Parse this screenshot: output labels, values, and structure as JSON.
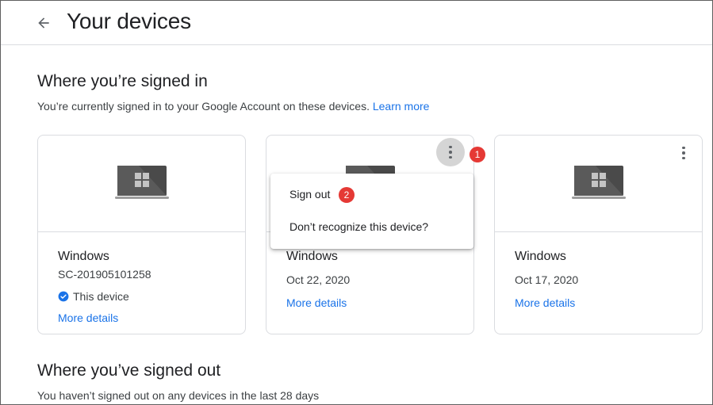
{
  "header": {
    "title": "Your devices"
  },
  "signed_in": {
    "title": "Where you’re signed in",
    "description": "You’re currently signed in to your Google Account on these devices.",
    "learn_more": "Learn more"
  },
  "devices": [
    {
      "name": "Windows",
      "detail": "SC-201905101258",
      "status": "This device",
      "more": "More details"
    },
    {
      "name": "Windows",
      "detail": "Oct 22, 2020",
      "more": "More details"
    },
    {
      "name": "Windows",
      "detail": "Oct 17, 2020",
      "more": "More details"
    }
  ],
  "menu": {
    "items": [
      {
        "label": "Sign out"
      },
      {
        "label": "Don’t recognize this device?"
      }
    ]
  },
  "badges": {
    "one": "1",
    "two": "2"
  },
  "signed_out": {
    "title": "Where you’ve signed out",
    "description": "You haven’t signed out on any devices in the last 28 days"
  },
  "colors": {
    "accent": "#1a73e8",
    "badge": "#e53935",
    "check": "#1a73e8"
  },
  "icons": [
    "back-arrow-icon",
    "laptop-icon",
    "more-vert-icon",
    "verified-check-icon"
  ]
}
